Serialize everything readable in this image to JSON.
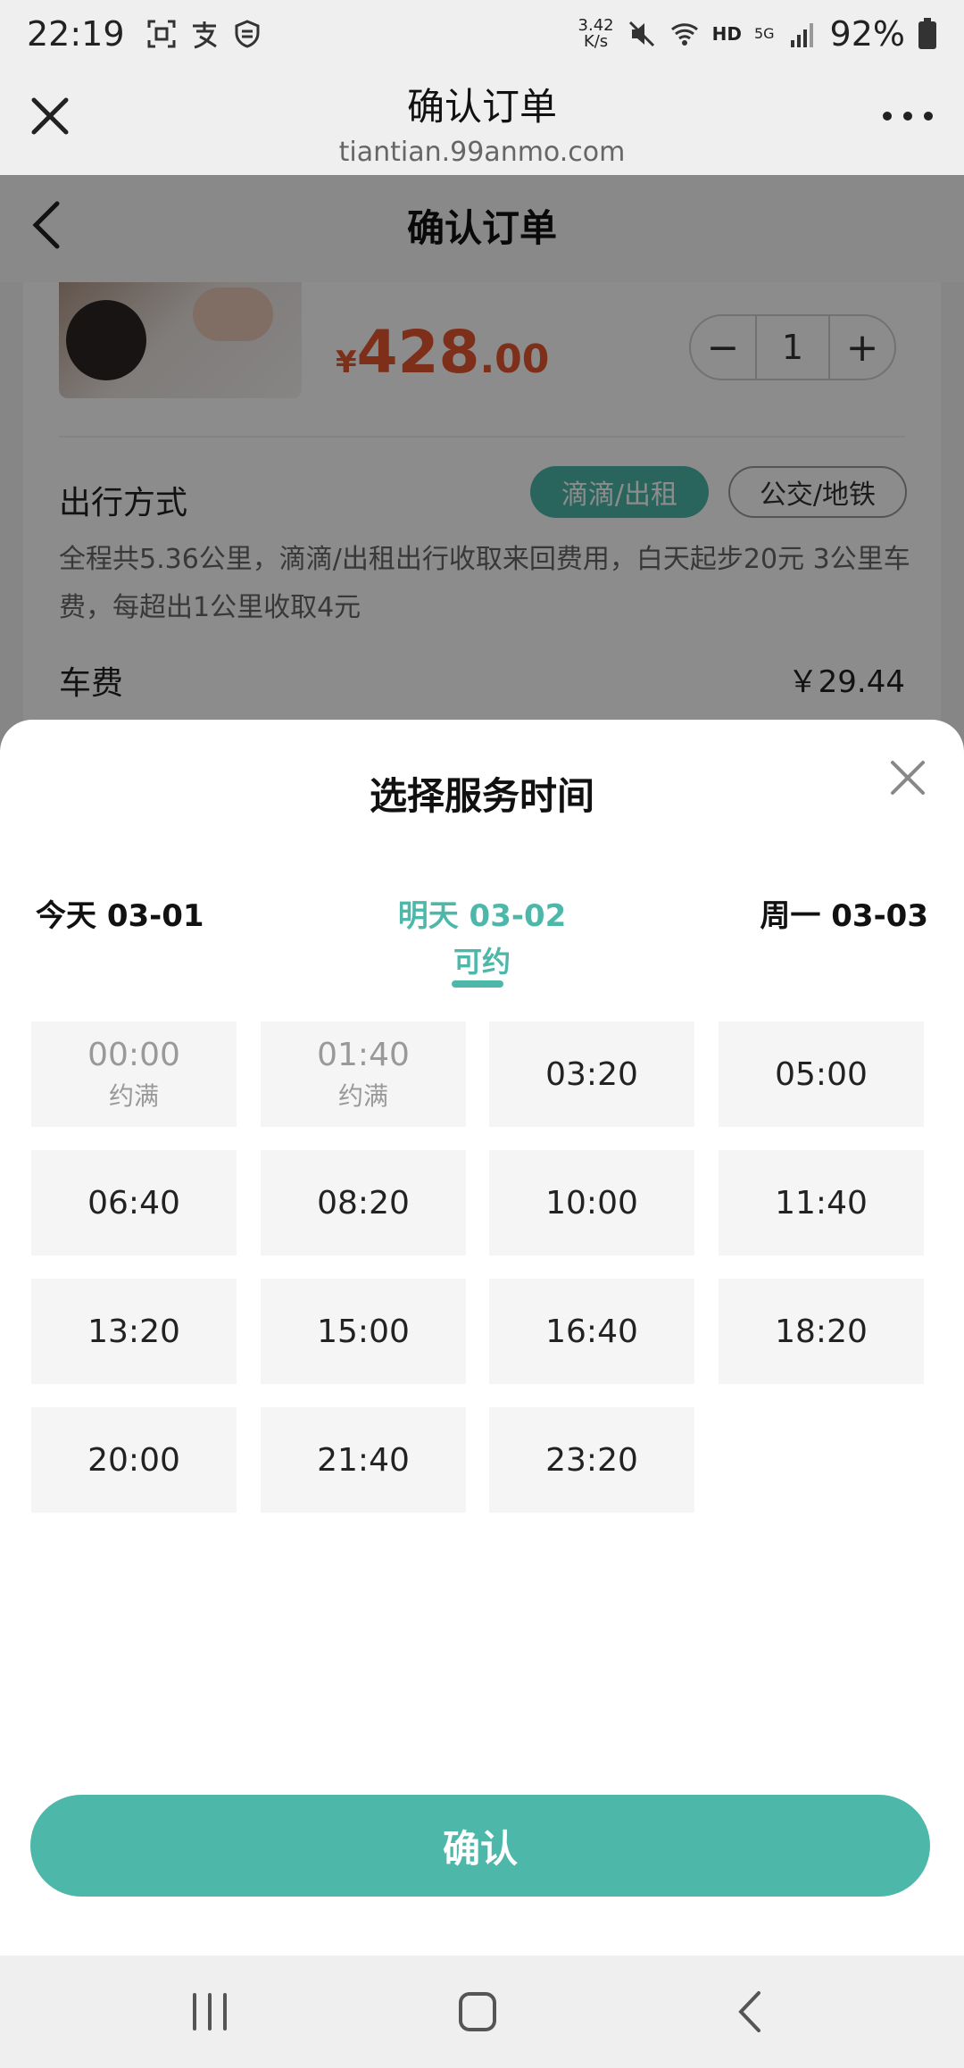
{
  "status_bar": {
    "time": "22:19",
    "net_speed_value": "3.42",
    "net_speed_unit": "K/s",
    "hd": "HD",
    "fiveg": "5G",
    "battery": "92%"
  },
  "web_bar": {
    "title": "确认订单",
    "url": "tiantian.99anmo.com"
  },
  "page": {
    "header_title": "确认订单",
    "price_currency": "¥",
    "price_int": "428",
    "price_dec": ".00",
    "quantity": "1",
    "stepper_minus": "−",
    "stepper_plus": "+",
    "travel_label": "出行方式",
    "travel_options": [
      "滴滴/出租",
      "公交/地铁"
    ],
    "travel_desc": "全程共5.36公里，滴滴/出租出行收取来回费用，白天起步20元 3公里车费，每超出1公里收取4元",
    "fee_label": "车费",
    "fee_value": "￥29.44"
  },
  "sheet": {
    "title": "选择服务时间",
    "days": [
      {
        "label": "今天 03-01"
      },
      {
        "label": "明天 03-02",
        "sub": "可约"
      },
      {
        "label": "周一 03-03"
      }
    ],
    "slots": [
      {
        "time": "00:00",
        "status": "约满"
      },
      {
        "time": "01:40",
        "status": "约满"
      },
      {
        "time": "03:20"
      },
      {
        "time": "05:00"
      },
      {
        "time": "06:40"
      },
      {
        "time": "08:20"
      },
      {
        "time": "10:00"
      },
      {
        "time": "11:40"
      },
      {
        "time": "13:20"
      },
      {
        "time": "15:00"
      },
      {
        "time": "16:40"
      },
      {
        "time": "18:20"
      },
      {
        "time": "20:00"
      },
      {
        "time": "21:40"
      },
      {
        "time": "23:20"
      }
    ],
    "confirm_label": "确认"
  },
  "colors": {
    "accent": "#4db8a9",
    "price": "#e4572e"
  }
}
